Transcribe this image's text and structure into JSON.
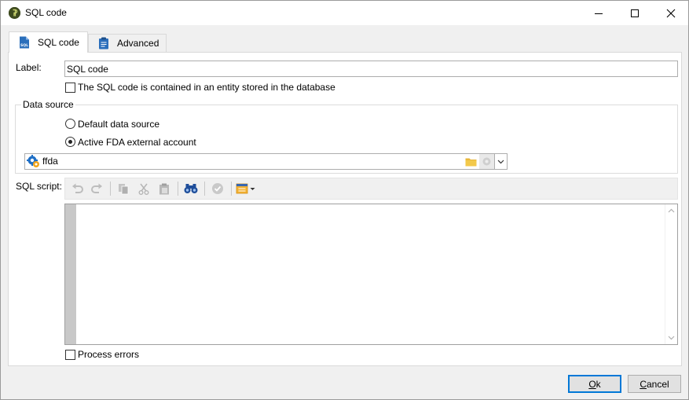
{
  "window": {
    "title": "SQL code"
  },
  "tabs": [
    {
      "label": "SQL code",
      "icon": "sql-file-icon"
    },
    {
      "label": "Advanced",
      "icon": "clipboard-icon"
    }
  ],
  "form": {
    "label_caption": "Label:",
    "label_value": "SQL code",
    "entity_checkbox_label": "The SQL code is contained in an entity stored in the database",
    "entity_checkbox_checked": false,
    "datasource_group_title": "Data source",
    "radio_default_label": "Default data source",
    "radio_fda_label": "Active FDA external account",
    "selected_datasource": "fda",
    "account_value": "ffda",
    "sql_script_caption": "SQL script:",
    "sql_script_content": "",
    "process_errors_label": "Process errors",
    "process_errors_checked": false
  },
  "toolbar_icons": [
    "undo-icon",
    "redo-icon",
    "copy-icon",
    "cut-icon",
    "paste-icon",
    "binoculars-icon",
    "check-icon",
    "insert-menu-icon"
  ],
  "buttons": {
    "ok_label": "Ok",
    "cancel_label": "Cancel"
  },
  "colors": {
    "accent": "#0078d7",
    "folder": "#e8b73a",
    "binoculars": "#1f4e9a"
  }
}
